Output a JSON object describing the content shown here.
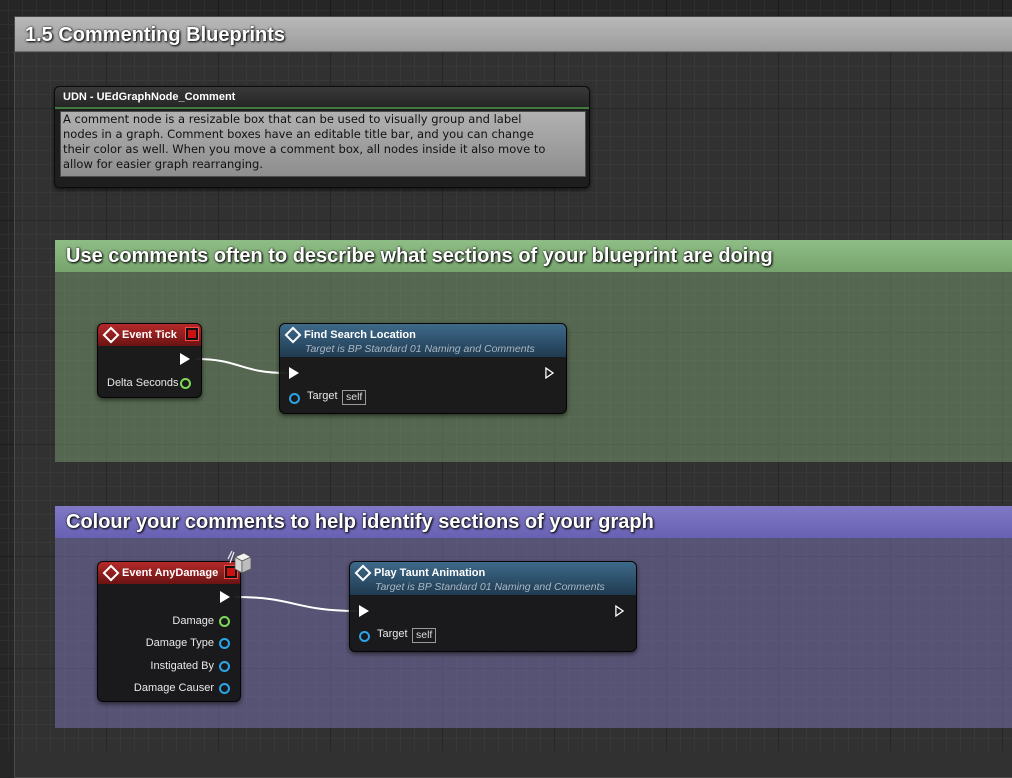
{
  "outer_comment": {
    "title": "1.5 Commenting Blueprints"
  },
  "udn_node": {
    "title": "UDN - UEdGraphNode_Comment",
    "body_lines": [
      "A comment node is a resizable box that can be used to visually group and label",
      "nodes in a graph. Comment boxes have an editable title bar, and you can change",
      "their color as well. When you move a comment box, all nodes inside it also move to",
      "allow for easier graph rearranging."
    ]
  },
  "green_comment": {
    "title": "Use comments often to describe what sections of your blueprint are doing",
    "color": "#8fbd86",
    "event_node": {
      "title": "Event Tick",
      "pin_delta": "Delta Seconds"
    },
    "function_node": {
      "title": "Find Search Location",
      "subtitle": "Target is BP Standard 01 Naming and Comments",
      "pin_target": "Target",
      "target_value": "self"
    }
  },
  "purple_comment": {
    "title": "Colour your comments to help identify sections of your graph",
    "color": "#7f79c6",
    "event_node": {
      "title": "Event AnyDamage",
      "pins": [
        "Damage",
        "Damage Type",
        "Instigated By",
        "Damage Causer"
      ]
    },
    "function_node": {
      "title": "Play Taunt Animation",
      "subtitle": "Target is BP Standard 01 Naming and Comments",
      "pin_target": "Target",
      "target_value": "self"
    }
  },
  "colors": {
    "event_header": "#b52a2a",
    "function_header": "#3e6a8a",
    "float_pin": "#7ed957",
    "object_pin": "#2aa6e8",
    "exec_pin": "#ffffff"
  }
}
